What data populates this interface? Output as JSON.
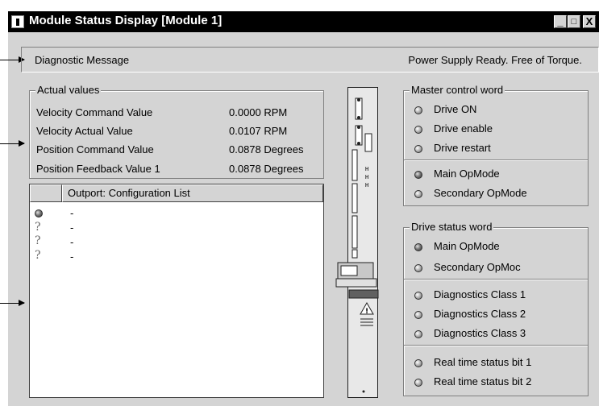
{
  "window": {
    "title": "Module Status Display [Module 1]",
    "buttons": [
      "_",
      "□",
      "X"
    ]
  },
  "diagnostic": {
    "label": "Diagnostic Message",
    "value": "Power Supply Ready. Free of Torque."
  },
  "actual_values": {
    "title": "Actual values",
    "rows": [
      {
        "label": "Velocity Command Value",
        "value": "0.0000 RPM"
      },
      {
        "label": "Velocity Actual Value",
        "value": "0.0107 RPM"
      },
      {
        "label": "Position Command Value",
        "value": "0.0878 Degrees"
      },
      {
        "label": "Position Feedback Value 1",
        "value": "0.0878 Degrees"
      }
    ]
  },
  "config_list": {
    "header": "Outport: Configuration List",
    "rows": [
      {
        "icon": "led-on-icon",
        "text": "-"
      },
      {
        "icon": "question-icon",
        "symbol": "?",
        "text": "-"
      },
      {
        "icon": "question-icon",
        "symbol": "?",
        "text": "-"
      },
      {
        "icon": "question-icon",
        "symbol": "?",
        "text": "-"
      }
    ]
  },
  "master_control_word": {
    "title": "Master control word",
    "items": [
      {
        "label": "Drive ON",
        "on": false
      },
      {
        "label": "Drive enable",
        "on": false
      },
      {
        "label": "Drive restart",
        "on": false
      },
      {
        "label": "Main OpMode",
        "on": true
      },
      {
        "label": "Secondary OpMode",
        "on": false
      }
    ]
  },
  "drive_status_word": {
    "title": "Drive status word",
    "items": [
      {
        "label": "Main OpMode",
        "on": true
      },
      {
        "label": "Secondary OpMoc",
        "on": false
      },
      {
        "label": "Diagnostics Class 1",
        "on": false
      },
      {
        "label": "Diagnostics Class 2",
        "on": false
      },
      {
        "label": "Diagnostics Class 3",
        "on": false
      },
      {
        "label": "Real time status bit 1",
        "on": false
      },
      {
        "label": "Real time status bit 2",
        "on": false
      }
    ]
  },
  "colors": {
    "face": "#d4d4d4",
    "titlebar": "#000000",
    "list_bg": "#ffffff"
  }
}
